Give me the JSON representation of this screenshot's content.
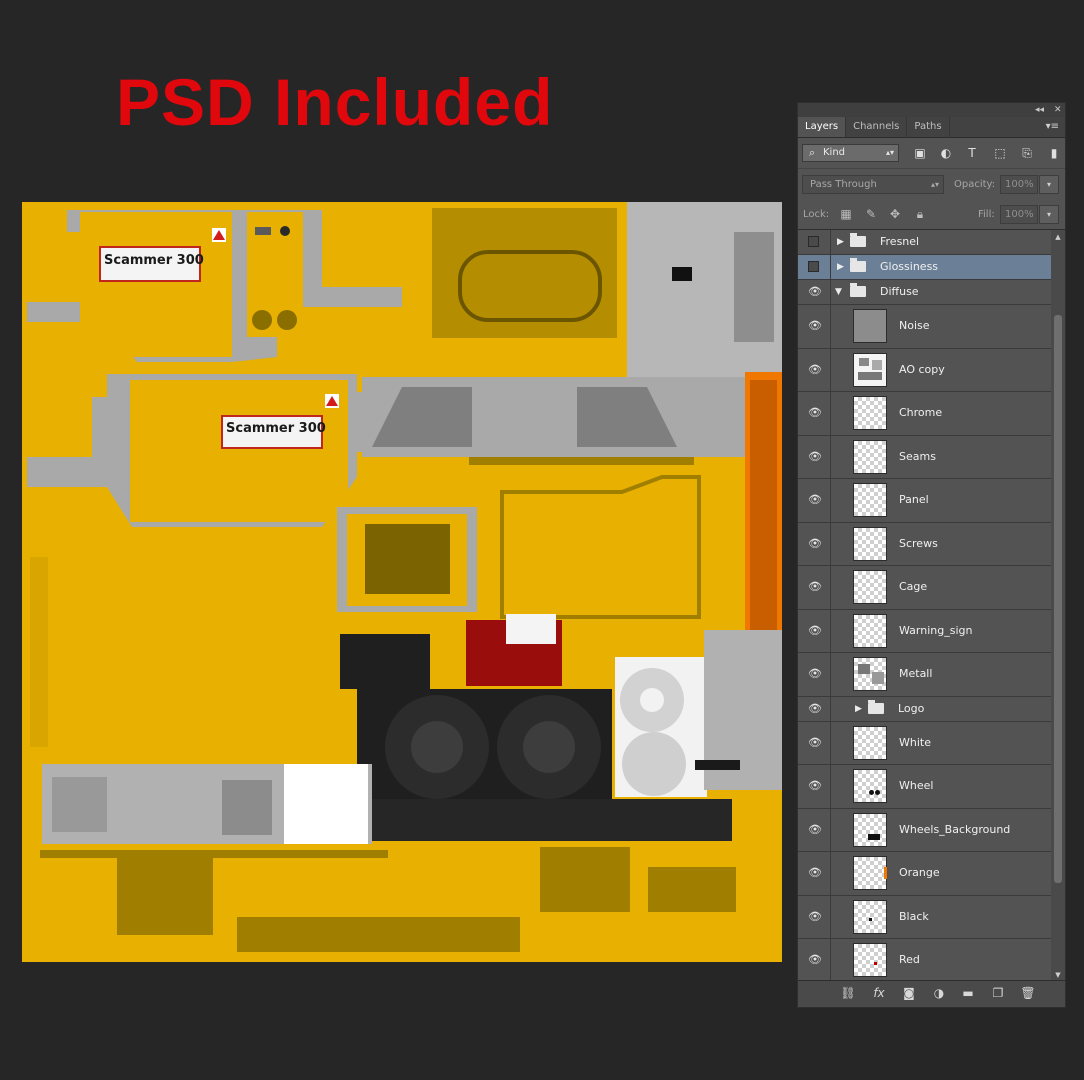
{
  "headline": "PSD Included",
  "texture": {
    "labels": [
      "Scammer 300",
      "Scammer 300"
    ],
    "colors": {
      "base": "#e8b000",
      "grey": "#a9a9a9",
      "dark": "#1f1f1f",
      "red": "#9a0d0d",
      "orange": "#f07800",
      "olive": "#7a6300"
    }
  },
  "panel": {
    "tabs": [
      {
        "label": "Layers",
        "active": true
      },
      {
        "label": "Channels",
        "active": false
      },
      {
        "label": "Paths",
        "active": false
      }
    ],
    "filter": {
      "label": "Kind",
      "icons": [
        "image-filter-icon",
        "adjustment-filter-icon",
        "type-filter-icon",
        "shape-filter-icon",
        "smart-object-filter-icon",
        "filter-toggle-icon"
      ]
    },
    "blend_mode": "Pass Through",
    "opacity_label": "Opacity:",
    "opacity_value": "100%",
    "lock_label": "Lock:",
    "fill_label": "Fill:",
    "fill_value": "100%",
    "layers": [
      {
        "name": "Fresnel",
        "type": "group",
        "visible": false,
        "expanded": false,
        "selected": false
      },
      {
        "name": "Glossiness",
        "type": "group",
        "visible": false,
        "expanded": false,
        "selected": true
      },
      {
        "name": "Diffuse",
        "type": "group",
        "visible": true,
        "expanded": true,
        "selected": false
      },
      {
        "name": "Noise",
        "type": "layer",
        "visible": true,
        "thumb": "noise"
      },
      {
        "name": "AO copy",
        "type": "layer",
        "visible": true,
        "thumb": "ao"
      },
      {
        "name": "Chrome",
        "type": "layer",
        "visible": true,
        "thumb": "empty"
      },
      {
        "name": "Seams",
        "type": "layer",
        "visible": true,
        "thumb": "empty"
      },
      {
        "name": "Panel",
        "type": "layer",
        "visible": true,
        "thumb": "empty"
      },
      {
        "name": "Screws",
        "type": "layer",
        "visible": true,
        "thumb": "empty"
      },
      {
        "name": "Cage",
        "type": "layer",
        "visible": true,
        "thumb": "empty"
      },
      {
        "name": "Warning_sign",
        "type": "layer",
        "visible": true,
        "thumb": "empty"
      },
      {
        "name": "Metall",
        "type": "layer",
        "visible": true,
        "thumb": "metall"
      },
      {
        "name": "Logo",
        "type": "subgroup",
        "visible": true,
        "expanded": false
      },
      {
        "name": "White",
        "type": "layer",
        "visible": true,
        "thumb": "empty"
      },
      {
        "name": "Wheel",
        "type": "layer",
        "visible": true,
        "thumb": "wheel"
      },
      {
        "name": "Wheels_Background",
        "type": "layer",
        "visible": true,
        "thumb": "wheelsbg"
      },
      {
        "name": "Orange",
        "type": "layer",
        "visible": true,
        "thumb": "orange"
      },
      {
        "name": "Black",
        "type": "layer",
        "visible": true,
        "thumb": "dot"
      },
      {
        "name": "Red",
        "type": "layer",
        "visible": true,
        "thumb": "dot"
      }
    ],
    "footer_icons": [
      "link-layers-icon",
      "fx-icon",
      "add-mask-icon",
      "adjustment-layer-icon",
      "new-group-icon",
      "new-layer-icon",
      "delete-layer-icon"
    ]
  }
}
